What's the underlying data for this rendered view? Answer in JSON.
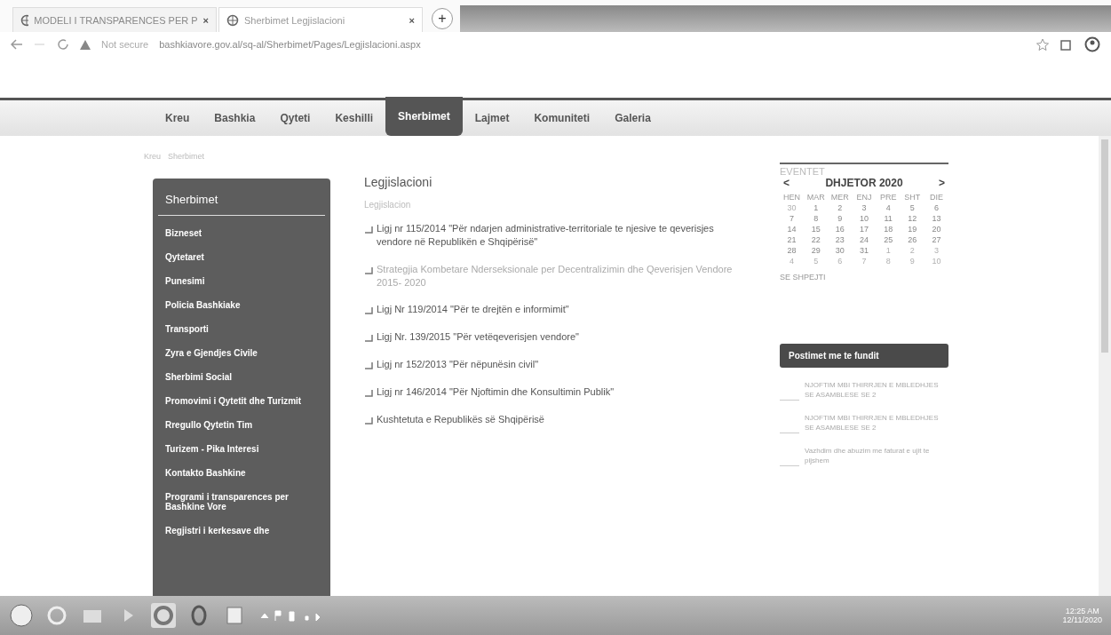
{
  "browser": {
    "tabs": [
      {
        "title": "MODELI I TRANSPARENCES PER P",
        "selected": false
      },
      {
        "title": "Sherbimet Legjislacioni",
        "selected": true
      }
    ],
    "new_tab": "+",
    "close": "×",
    "security": "Not secure",
    "url": "bashkiavore.gov.al/sq-al/Sherbimet/Pages/Legjislacioni.aspx"
  },
  "nav": [
    {
      "label": "Kreu",
      "selected": false
    },
    {
      "label": "Bashkia",
      "selected": false
    },
    {
      "label": "Qyteti",
      "selected": false
    },
    {
      "label": "Keshilli",
      "selected": false
    },
    {
      "label": "Sherbimet",
      "selected": true
    },
    {
      "label": "Lajmet",
      "selected": false
    },
    {
      "label": "Komuniteti",
      "selected": false
    },
    {
      "label": "Galeria",
      "selected": false
    }
  ],
  "breadcrumb": [
    "Kreu",
    "Sherbimet"
  ],
  "sidebar": {
    "title": "Sherbimet",
    "items": [
      "Bizneset",
      "Qytetaret",
      "Punesimi",
      "Policia Bashkiake",
      "Transporti",
      "Zyra e Gjendjes Civile",
      "Sherbimi Social",
      "Promovimi i Qytetit dhe Turizmit",
      "Rregullo Qytetin Tim",
      "Turizem - Pika Interesi",
      "Kontakto Bashkine",
      "Programi i transparences per Bashkine Vore",
      "Regjistri i kerkesave dhe"
    ]
  },
  "content": {
    "title": "Legjislacioni",
    "subtitle": "Legjislacion",
    "documents": [
      {
        "title": "Ligj nr 115/2014 \"Për ndarjen administrative-territoriale te njesive te qeverisjes vendore në Republikën e Shqipërisë\"",
        "visited": false
      },
      {
        "title": "Strategjia Kombetare Nderseksionale per Decentralizimin dhe Qeverisjen Vendore 2015- 2020",
        "visited": true
      },
      {
        "title": "Ligj Nr 119/2014 \"Për te drejtën e informimit\"",
        "visited": false
      },
      {
        "title": "Ligj Nr. 139/2015 \"Për vetëqeverisjen vendore\"",
        "visited": false
      },
      {
        "title": "Ligj nr 152/2013 \"Për nëpunësin civil\"",
        "visited": false
      },
      {
        "title": "Ligj nr 146/2014 \"Për Njoftimin dhe Konsultimin Publik\"",
        "visited": false
      },
      {
        "title": "Kushtetuta e Republikës së Shqipërisë",
        "visited": false
      }
    ]
  },
  "events": {
    "title": "EVENTET",
    "prev": "<",
    "month": "DHJETOR 2020",
    "next": ">",
    "weekdays": [
      "HEN",
      "MAR",
      "MER",
      "ENJ",
      "PRE",
      "SHT",
      "DIE"
    ],
    "days": [
      {
        "d": "30",
        "current": false
      },
      {
        "d": "1",
        "current": true
      },
      {
        "d": "2",
        "current": true
      },
      {
        "d": "3",
        "current": true
      },
      {
        "d": "4",
        "current": true
      },
      {
        "d": "5",
        "current": true
      },
      {
        "d": "6",
        "current": true
      },
      {
        "d": "7",
        "current": true
      },
      {
        "d": "8",
        "current": true
      },
      {
        "d": "9",
        "current": true
      },
      {
        "d": "10",
        "current": true
      },
      {
        "d": "11",
        "current": true
      },
      {
        "d": "12",
        "current": true
      },
      {
        "d": "13",
        "current": true
      },
      {
        "d": "14",
        "current": true
      },
      {
        "d": "15",
        "current": true
      },
      {
        "d": "16",
        "current": true
      },
      {
        "d": "17",
        "current": true
      },
      {
        "d": "18",
        "current": true
      },
      {
        "d": "19",
        "current": true
      },
      {
        "d": "20",
        "current": true
      },
      {
        "d": "21",
        "current": true
      },
      {
        "d": "22",
        "current": true
      },
      {
        "d": "23",
        "current": true
      },
      {
        "d": "24",
        "current": true
      },
      {
        "d": "25",
        "current": true
      },
      {
        "d": "26",
        "current": true
      },
      {
        "d": "27",
        "current": true
      },
      {
        "d": "28",
        "current": true
      },
      {
        "d": "29",
        "current": true
      },
      {
        "d": "30",
        "current": true
      },
      {
        "d": "31",
        "current": true
      },
      {
        "d": "1",
        "current": false
      },
      {
        "d": "2",
        "current": false
      },
      {
        "d": "3",
        "current": false
      },
      {
        "d": "4",
        "current": false
      },
      {
        "d": "5",
        "current": false
      },
      {
        "d": "6",
        "current": false
      },
      {
        "d": "7",
        "current": false
      },
      {
        "d": "8",
        "current": false
      },
      {
        "d": "9",
        "current": false
      },
      {
        "d": "10",
        "current": false
      }
    ],
    "upcoming": "SE SHPEJTI"
  },
  "posts": {
    "title": "Postimet me te fundit",
    "items": [
      "NJOFTIM MBI THIRRJEN E MBLEDHJES SE ASAMBLESE SE 2",
      "NJOFTIM MBI THIRRJEN E MBLEDHJES SE ASAMBLESE SE 2",
      "Vazhdim dhe abuzim me faturat e ujit te pijshem"
    ]
  },
  "taskbar": {
    "time": "12:25 AM",
    "date": "12/11/2020"
  }
}
